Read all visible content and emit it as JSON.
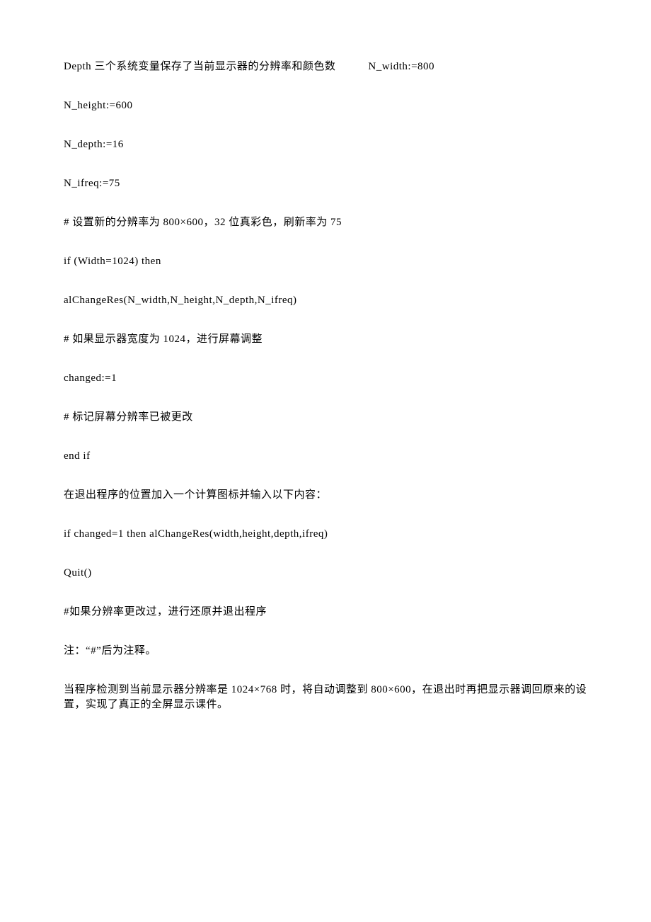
{
  "lines": {
    "l1a": "Depth 三个系统变量保存了当前显示器的分辨率和颜色数",
    "l1b": "N_width:=800",
    "l2": "N_height:=600",
    "l3": "N_depth:=16",
    "l4": "N_ifreq:=75",
    "l5": "# 设置新的分辨率为 800×600，32 位真彩色，刷新率为 75",
    "l6": "if (Width=1024) then",
    "l7": "alChangeRes(N_width,N_height,N_depth,N_ifreq)",
    "l8": "# 如果显示器宽度为 1024，进行屏幕调整",
    "l9": "changed:=1",
    "l10": "# 标记屏幕分辨率已被更改",
    "l11": "end if",
    "l12": "在退出程序的位置加入一个计算图标并输入以下内容：",
    "l13": "if changed=1 then alChangeRes(width,height,depth,ifreq)",
    "l14": "Quit()",
    "l15": "#如果分辨率更改过，进行还原并退出程序",
    "l16": "注：“#”后为注释。",
    "l17": "当程序检测到当前显示器分辨率是 1024×768 时，将自动调整到 800×600，在退出时再把显示器调回原来的设置，实现了真正的全屏显示课件。"
  }
}
